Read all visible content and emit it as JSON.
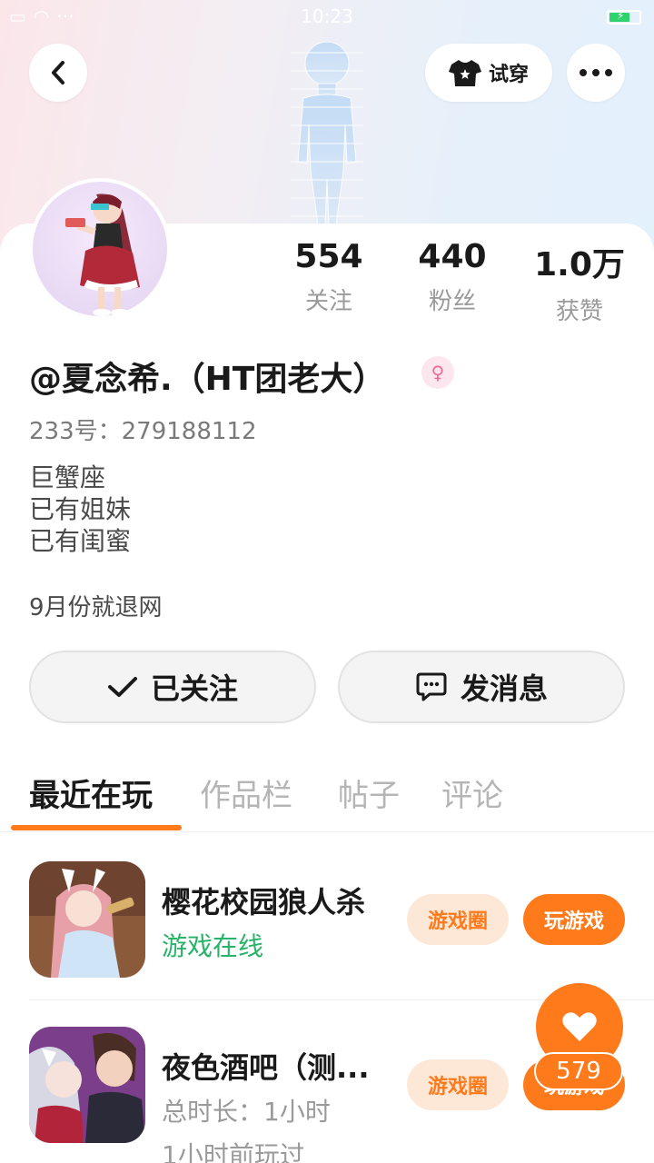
{
  "status_bar": {
    "time": "10:23"
  },
  "header": {
    "tryon_label": "试穿"
  },
  "profile": {
    "stats": [
      {
        "value": "554",
        "label": "关注"
      },
      {
        "value": "440",
        "label": "粉丝"
      },
      {
        "value": "1.0万",
        "label": "获赞"
      }
    ],
    "nickname": "@夏念希.（HT团老大）",
    "gender_symbol": "♀",
    "uid": "233号：279188112",
    "bio_lines": [
      "巨蟹座",
      "已有姐妹",
      "已有闺蜜"
    ],
    "note": "9月份就退网"
  },
  "actions": {
    "follow_label": "已关注",
    "message_label": "发消息"
  },
  "tabs": [
    "最近在玩",
    "作品栏",
    "帖子",
    "评论"
  ],
  "games": [
    {
      "title": "樱花校园狼人杀",
      "status": "游戏在线",
      "circle_label": "游戏圈",
      "play_label": "玩游戏"
    },
    {
      "title": "夜色酒吧（测...",
      "duration": "总时长：1小时",
      "last_played": "1小时前玩过",
      "circle_label": "游戏圈",
      "play_label": "玩游戏"
    }
  ],
  "like": {
    "count": "579"
  },
  "colors": {
    "accent": "#ff7a1a",
    "online": "#27b368",
    "gender": "#f06b9a"
  }
}
